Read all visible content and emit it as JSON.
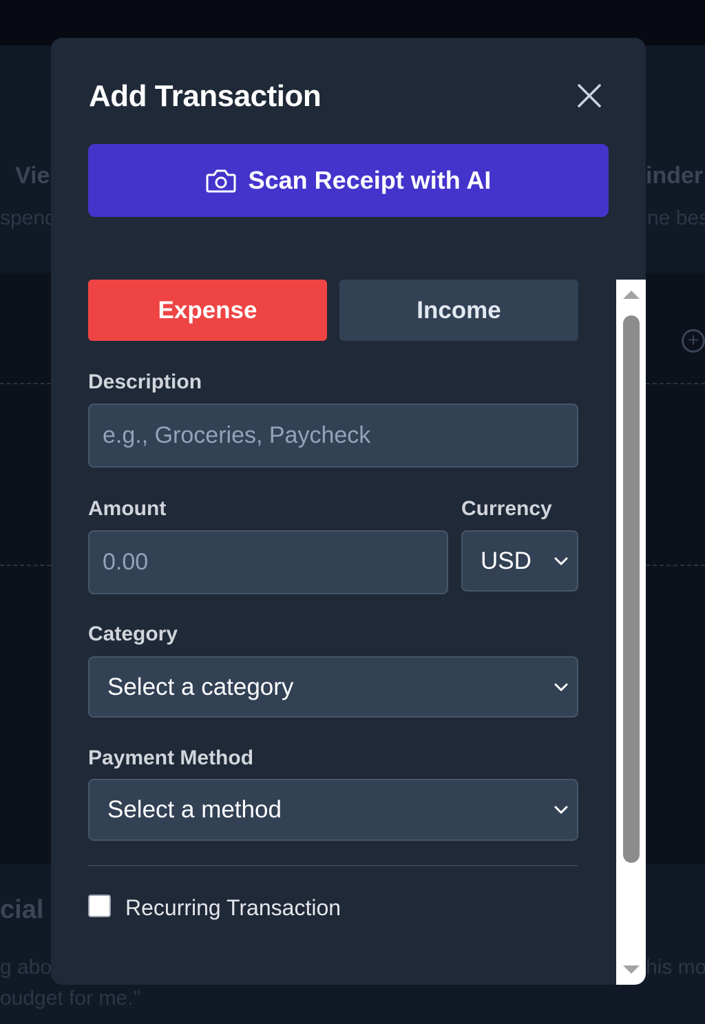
{
  "background": {
    "card_left_title": "Vie",
    "card_left_sub": "spend",
    "card_right_title": "inder",
    "card_right_sub": "ne bes",
    "bottom_left_title": "cial",
    "bottom_left_line1": "g abo",
    "bottom_left_line2": "oudget for me.\"",
    "bottom_right_line1": "his mo"
  },
  "modal": {
    "title": "Add Transaction",
    "scan_button_label": "Scan Receipt with AI",
    "type_toggle": {
      "expense_label": "Expense",
      "income_label": "Income",
      "selected": "Expense"
    },
    "description": {
      "label": "Description",
      "placeholder": "e.g., Groceries, Paycheck",
      "value": ""
    },
    "amount": {
      "label": "Amount",
      "placeholder": "0.00",
      "value": ""
    },
    "currency": {
      "label": "Currency",
      "selected": "USD"
    },
    "category": {
      "label": "Category",
      "selected": "Select a category"
    },
    "payment_method": {
      "label": "Payment Method",
      "selected": "Select a method"
    },
    "recurring": {
      "label": "Recurring Transaction",
      "checked": false
    }
  },
  "colors": {
    "primary": "#4434cc",
    "expense": "#ef4444",
    "modal_bg": "#1f2937",
    "field_bg": "#334155"
  }
}
